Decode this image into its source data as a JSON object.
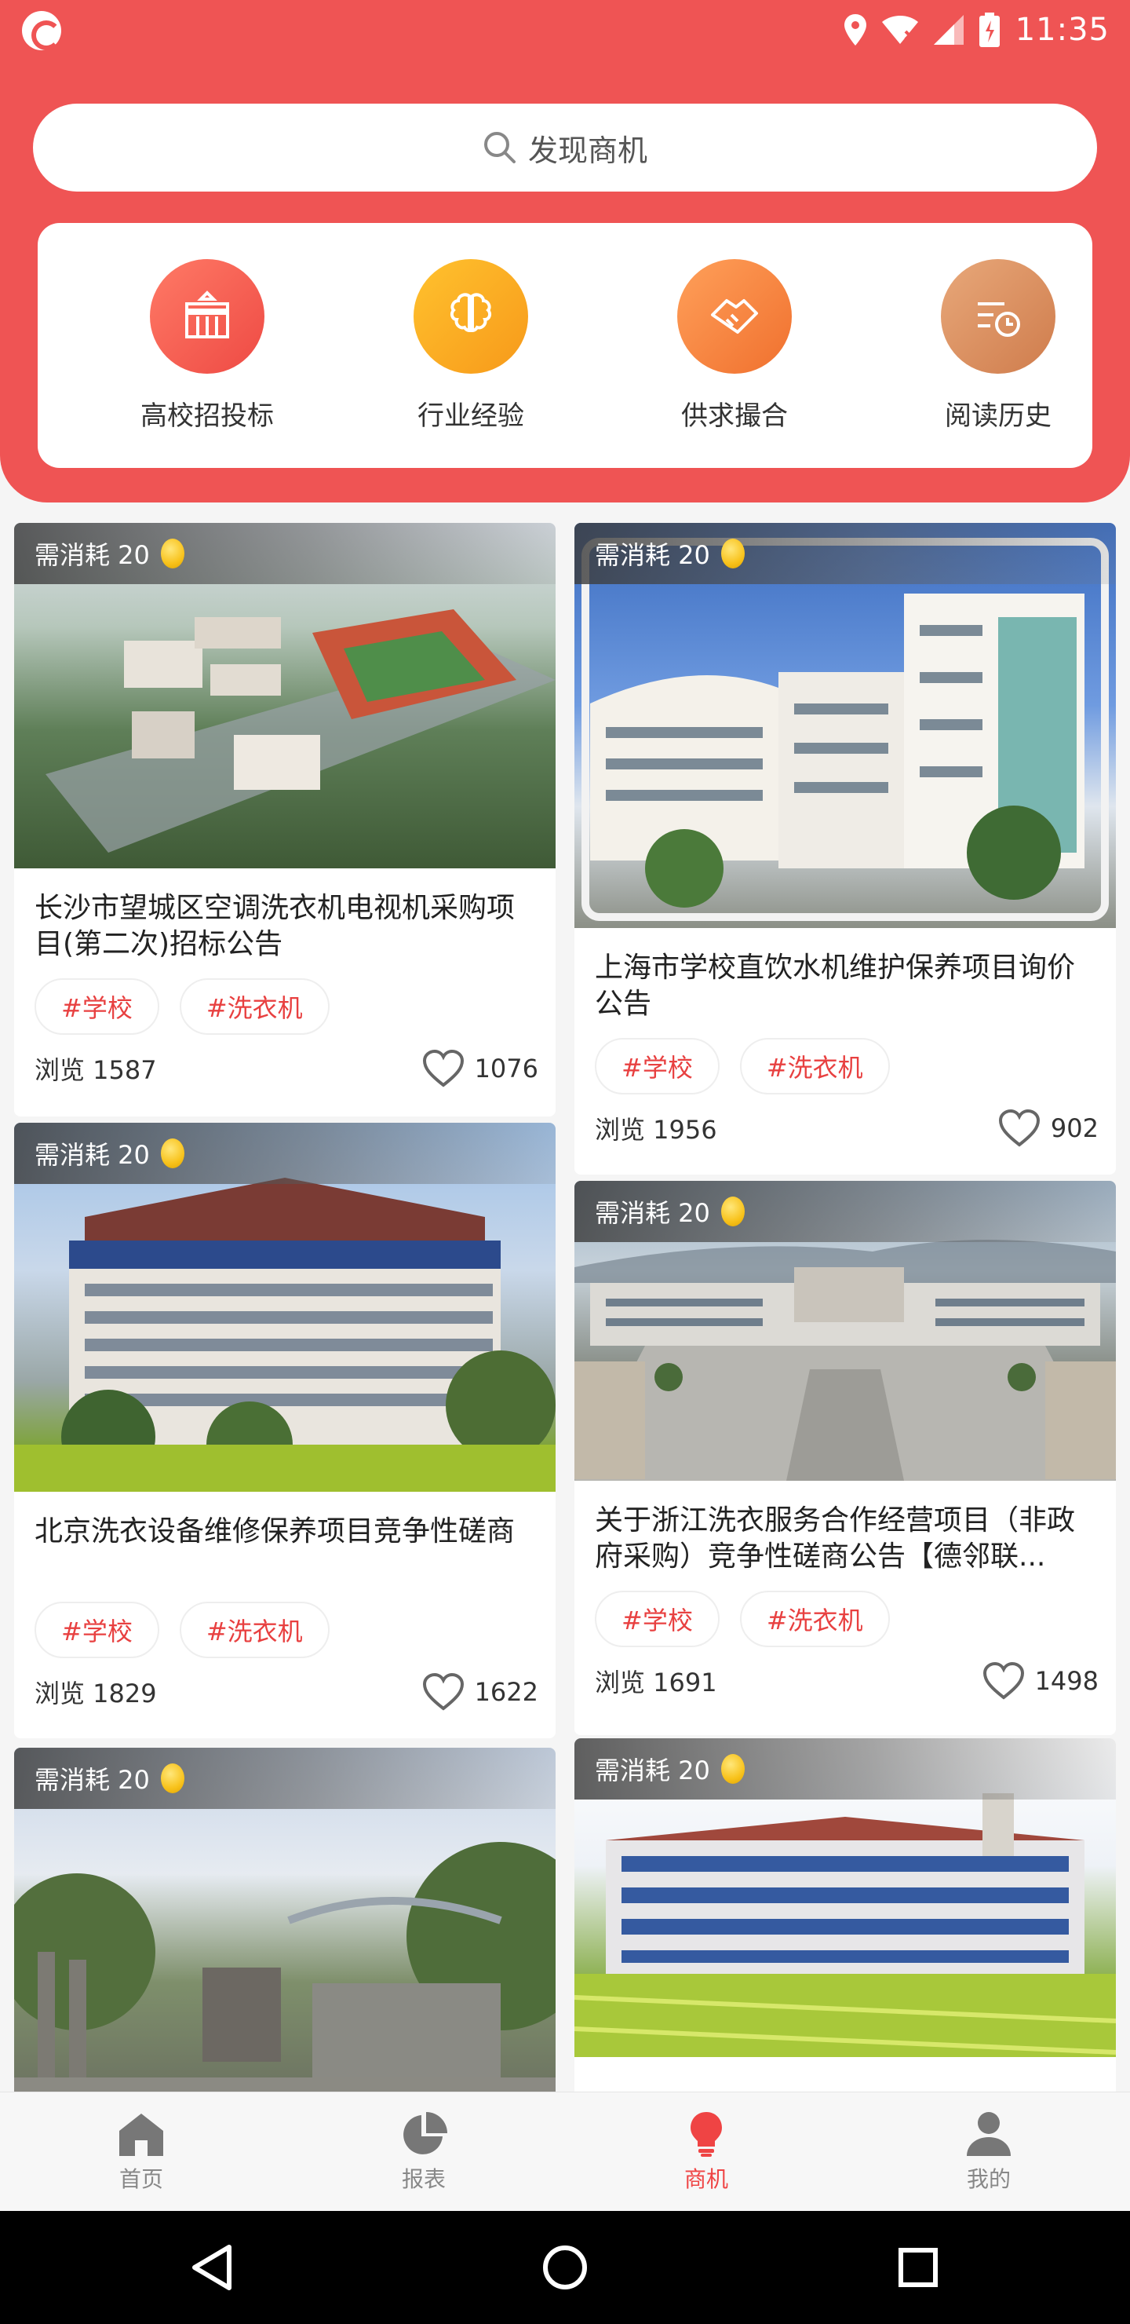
{
  "status_bar": {
    "time": "11:35"
  },
  "search": {
    "placeholder": "发现商机"
  },
  "categories": [
    {
      "label": "高校招投标",
      "icon": "school-building-icon",
      "color": "#f0554d"
    },
    {
      "label": "行业经验",
      "icon": "brain-icon",
      "color": "#f9a21a"
    },
    {
      "label": "供求撮合",
      "icon": "handshake-icon",
      "color": "#f37f3a"
    },
    {
      "label": "阅读历史",
      "icon": "history-clock-icon",
      "color": "#d98d5c"
    }
  ],
  "cards": [
    {
      "cost": "需消耗 20",
      "title": "长沙市望城区空调洗衣机电视机采购项目(第二次)招标公告",
      "tags": [
        "#学校",
        "#洗衣机"
      ],
      "views": "浏览 1587",
      "likes": "1076"
    },
    {
      "cost": "需消耗 20",
      "title": "上海市学校直饮水机维护保养项目询价公告",
      "tags": [
        "#学校",
        "#洗衣机"
      ],
      "views": "浏览 1956",
      "likes": "902"
    },
    {
      "cost": "需消耗 20",
      "title": "北京洗衣设备维修保养项目竞争性磋商",
      "tags": [
        "#学校",
        "#洗衣机"
      ],
      "views": "浏览 1829",
      "likes": "1622"
    },
    {
      "cost": "需消耗 20",
      "title": "关于浙江洗衣服务合作经营项目（非政府采购）竞争性磋商公告【德邻联...",
      "tags": [
        "#学校",
        "#洗衣机"
      ],
      "views": "浏览 1691",
      "likes": "1498"
    },
    {
      "cost": "需消耗 20"
    },
    {
      "cost": "需消耗 20"
    }
  ],
  "tabbar": [
    {
      "label": "首页",
      "icon": "home-icon"
    },
    {
      "label": "报表",
      "icon": "pie-chart-icon"
    },
    {
      "label": "商机",
      "icon": "lightbulb-icon",
      "active": true
    },
    {
      "label": "我的",
      "icon": "user-icon"
    }
  ],
  "colors": {
    "primary": "#ef5454",
    "accent_red": "#e84040",
    "tab_active": "#ef4444"
  }
}
